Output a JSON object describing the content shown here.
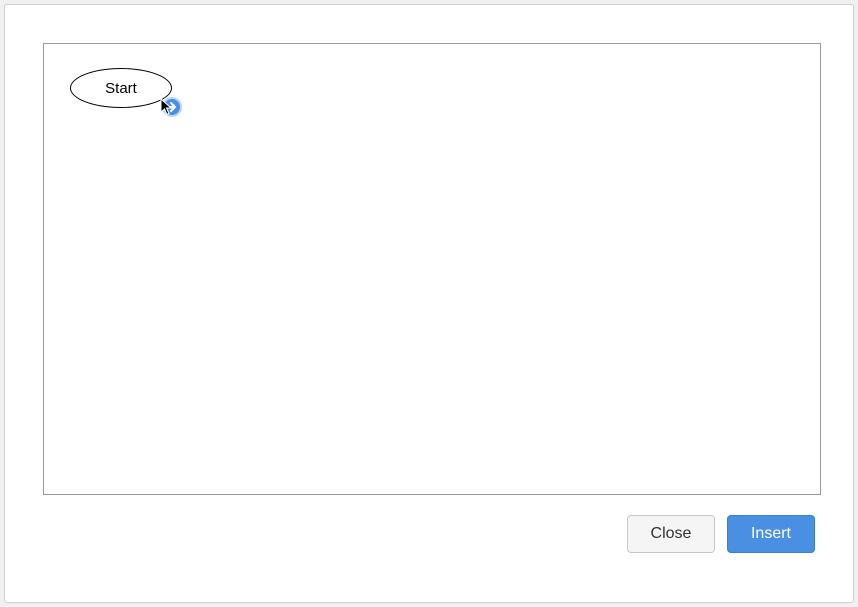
{
  "canvas": {
    "nodes": [
      {
        "label": "Start",
        "shape": "ellipse"
      }
    ]
  },
  "handle": {
    "direction": "right"
  },
  "buttons": {
    "close": "Close",
    "insert": "Insert"
  },
  "colors": {
    "primary": "#4a90e2",
    "handle_fill": "#4a90e2",
    "handle_ring": "#a8cef5"
  }
}
